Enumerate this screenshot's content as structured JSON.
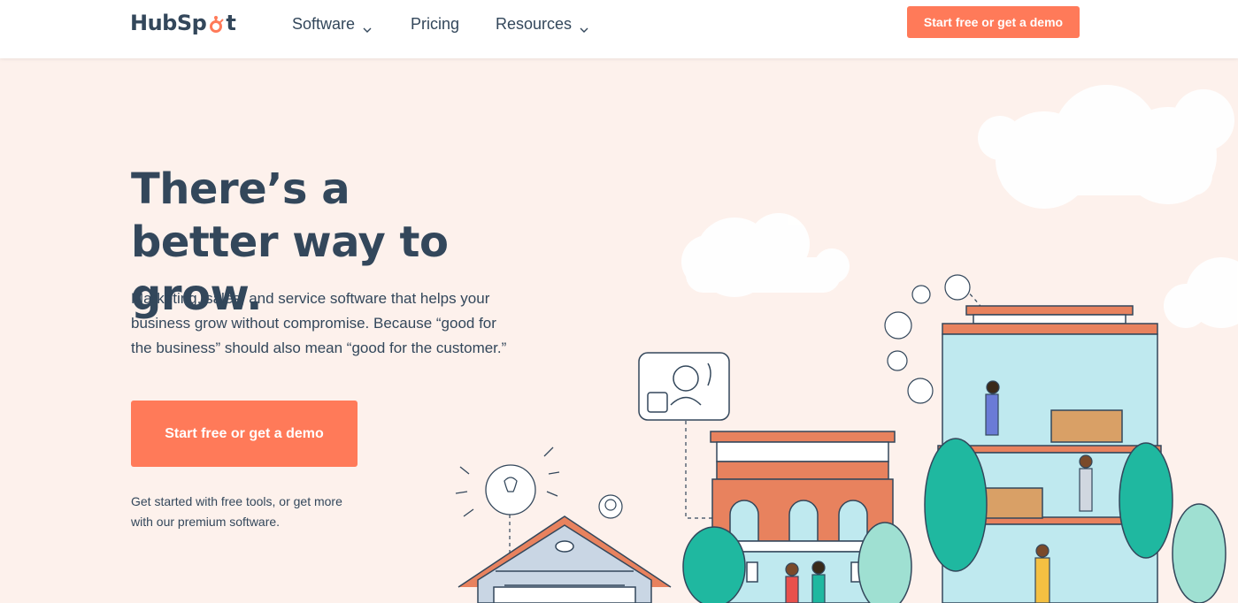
{
  "header": {
    "logo_text_a": "HubSp",
    "logo_text_b": "t",
    "nav": [
      {
        "label": "Software",
        "has_dropdown": true
      },
      {
        "label": "Pricing",
        "has_dropdown": false
      },
      {
        "label": "Resources",
        "has_dropdown": true
      }
    ],
    "cta_label": "Start free or get a demo"
  },
  "hero": {
    "title": "There’s a better way to grow.",
    "subtitle": "Marketing, sales, and service software that helps your business grow without compromise. Because “good for the business” should also mean “good for the customer.”",
    "cta_label": "Start free or get a demo",
    "note": "Get started with free tools, or get more with our premium software."
  },
  "colors": {
    "accent": "#ff7a59",
    "text": "#33475b",
    "background": "#fdf1ec",
    "teal": "#1fb8a0",
    "sky_glass": "#bfe9ef",
    "brick": "#e8825e"
  }
}
